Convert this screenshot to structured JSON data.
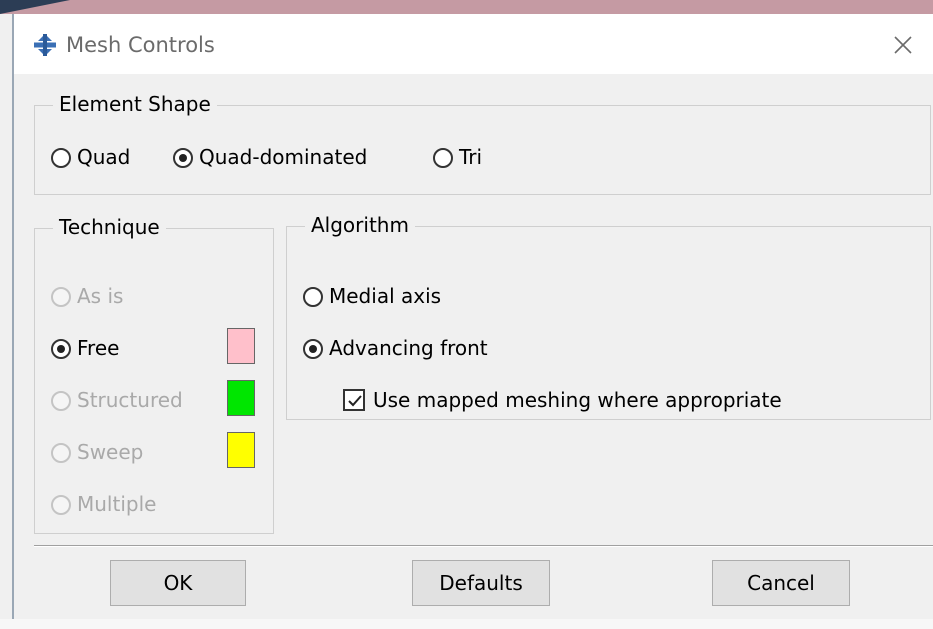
{
  "window": {
    "title": "Mesh Controls",
    "close_icon": "close-icon",
    "app_icon": "mesh-controls-app-icon"
  },
  "element_shape": {
    "legend": "Element Shape",
    "options": [
      {
        "label": "Quad",
        "checked": false
      },
      {
        "label": "Quad-dominated",
        "checked": true
      },
      {
        "label": "Tri",
        "checked": false
      }
    ]
  },
  "technique": {
    "legend": "Technique",
    "options": [
      {
        "label": "As is",
        "checked": false,
        "enabled": false
      },
      {
        "label": "Free",
        "checked": true,
        "enabled": true,
        "swatch_color": "#ffc0cb"
      },
      {
        "label": "Structured",
        "checked": false,
        "enabled": false,
        "swatch_color": "#00e600"
      },
      {
        "label": "Sweep",
        "checked": false,
        "enabled": false,
        "swatch_color": "#ffff00"
      },
      {
        "label": "Multiple",
        "checked": false,
        "enabled": false
      }
    ]
  },
  "algorithm": {
    "legend": "Algorithm",
    "options": [
      {
        "label": "Medial axis",
        "checked": false
      },
      {
        "label": "Advancing front",
        "checked": true
      }
    ],
    "mapped_meshing": {
      "label": "Use mapped meshing where appropriate",
      "checked": true
    }
  },
  "buttons": {
    "ok": "OK",
    "defaults": "Defaults",
    "cancel": "Cancel"
  }
}
